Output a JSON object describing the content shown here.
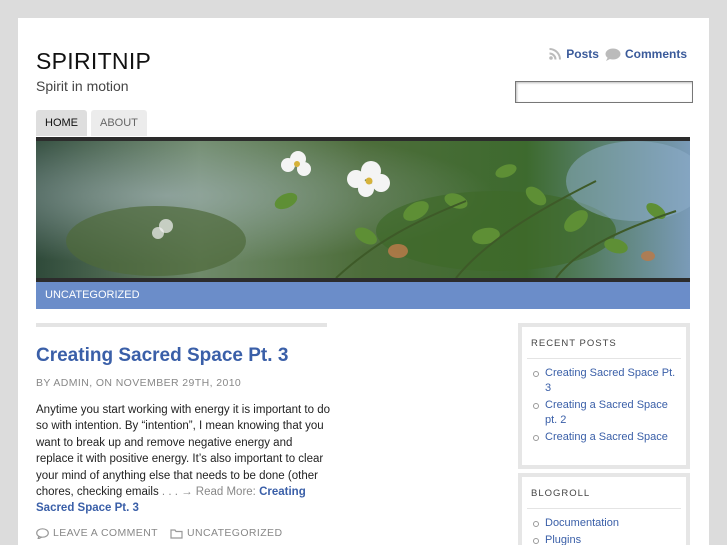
{
  "site": {
    "title": "SPIRITNIP",
    "tagline": "Spirit in motion"
  },
  "feeds": {
    "posts": "Posts",
    "comments": "Comments"
  },
  "search": {
    "placeholder": ""
  },
  "nav": {
    "tabs": [
      {
        "label": "HOME",
        "active": true
      },
      {
        "label": "ABOUT",
        "active": false
      }
    ]
  },
  "category_bar": {
    "label": "UNCATEGORIZED"
  },
  "post": {
    "title": "Creating Sacred Space Pt. 3",
    "meta": "BY ADMIN, ON NOVEMBER 29TH, 2010",
    "body": "Anytime you start working with energy it is important to do so with intention. By “intention”, I mean knowing that you want to break up and remove negative energy and replace it with positive energy. It’s also important to clear your mind of anything else that needs to be done (other chores, checking emails",
    "more_prefix": " . . . → Read More: ",
    "more_link": "Creating Sacred Space Pt. 3",
    "leave_comment": "LEAVE A COMMENT",
    "category": "UNCATEGORIZED"
  },
  "sidebar": {
    "recent_posts": {
      "title": "RECENT POSTS",
      "items": [
        "Creating Sacred Space Pt. 3",
        "Creating a Sacred Space pt. 2",
        "Creating a Sacred Space"
      ]
    },
    "blogroll": {
      "title": "BLOGROLL",
      "items": [
        "Documentation",
        "Plugins"
      ]
    }
  },
  "colors": {
    "accent": "#3a5fa8",
    "category_bar": "#6b8dc9",
    "background": "#dcdcdc"
  }
}
